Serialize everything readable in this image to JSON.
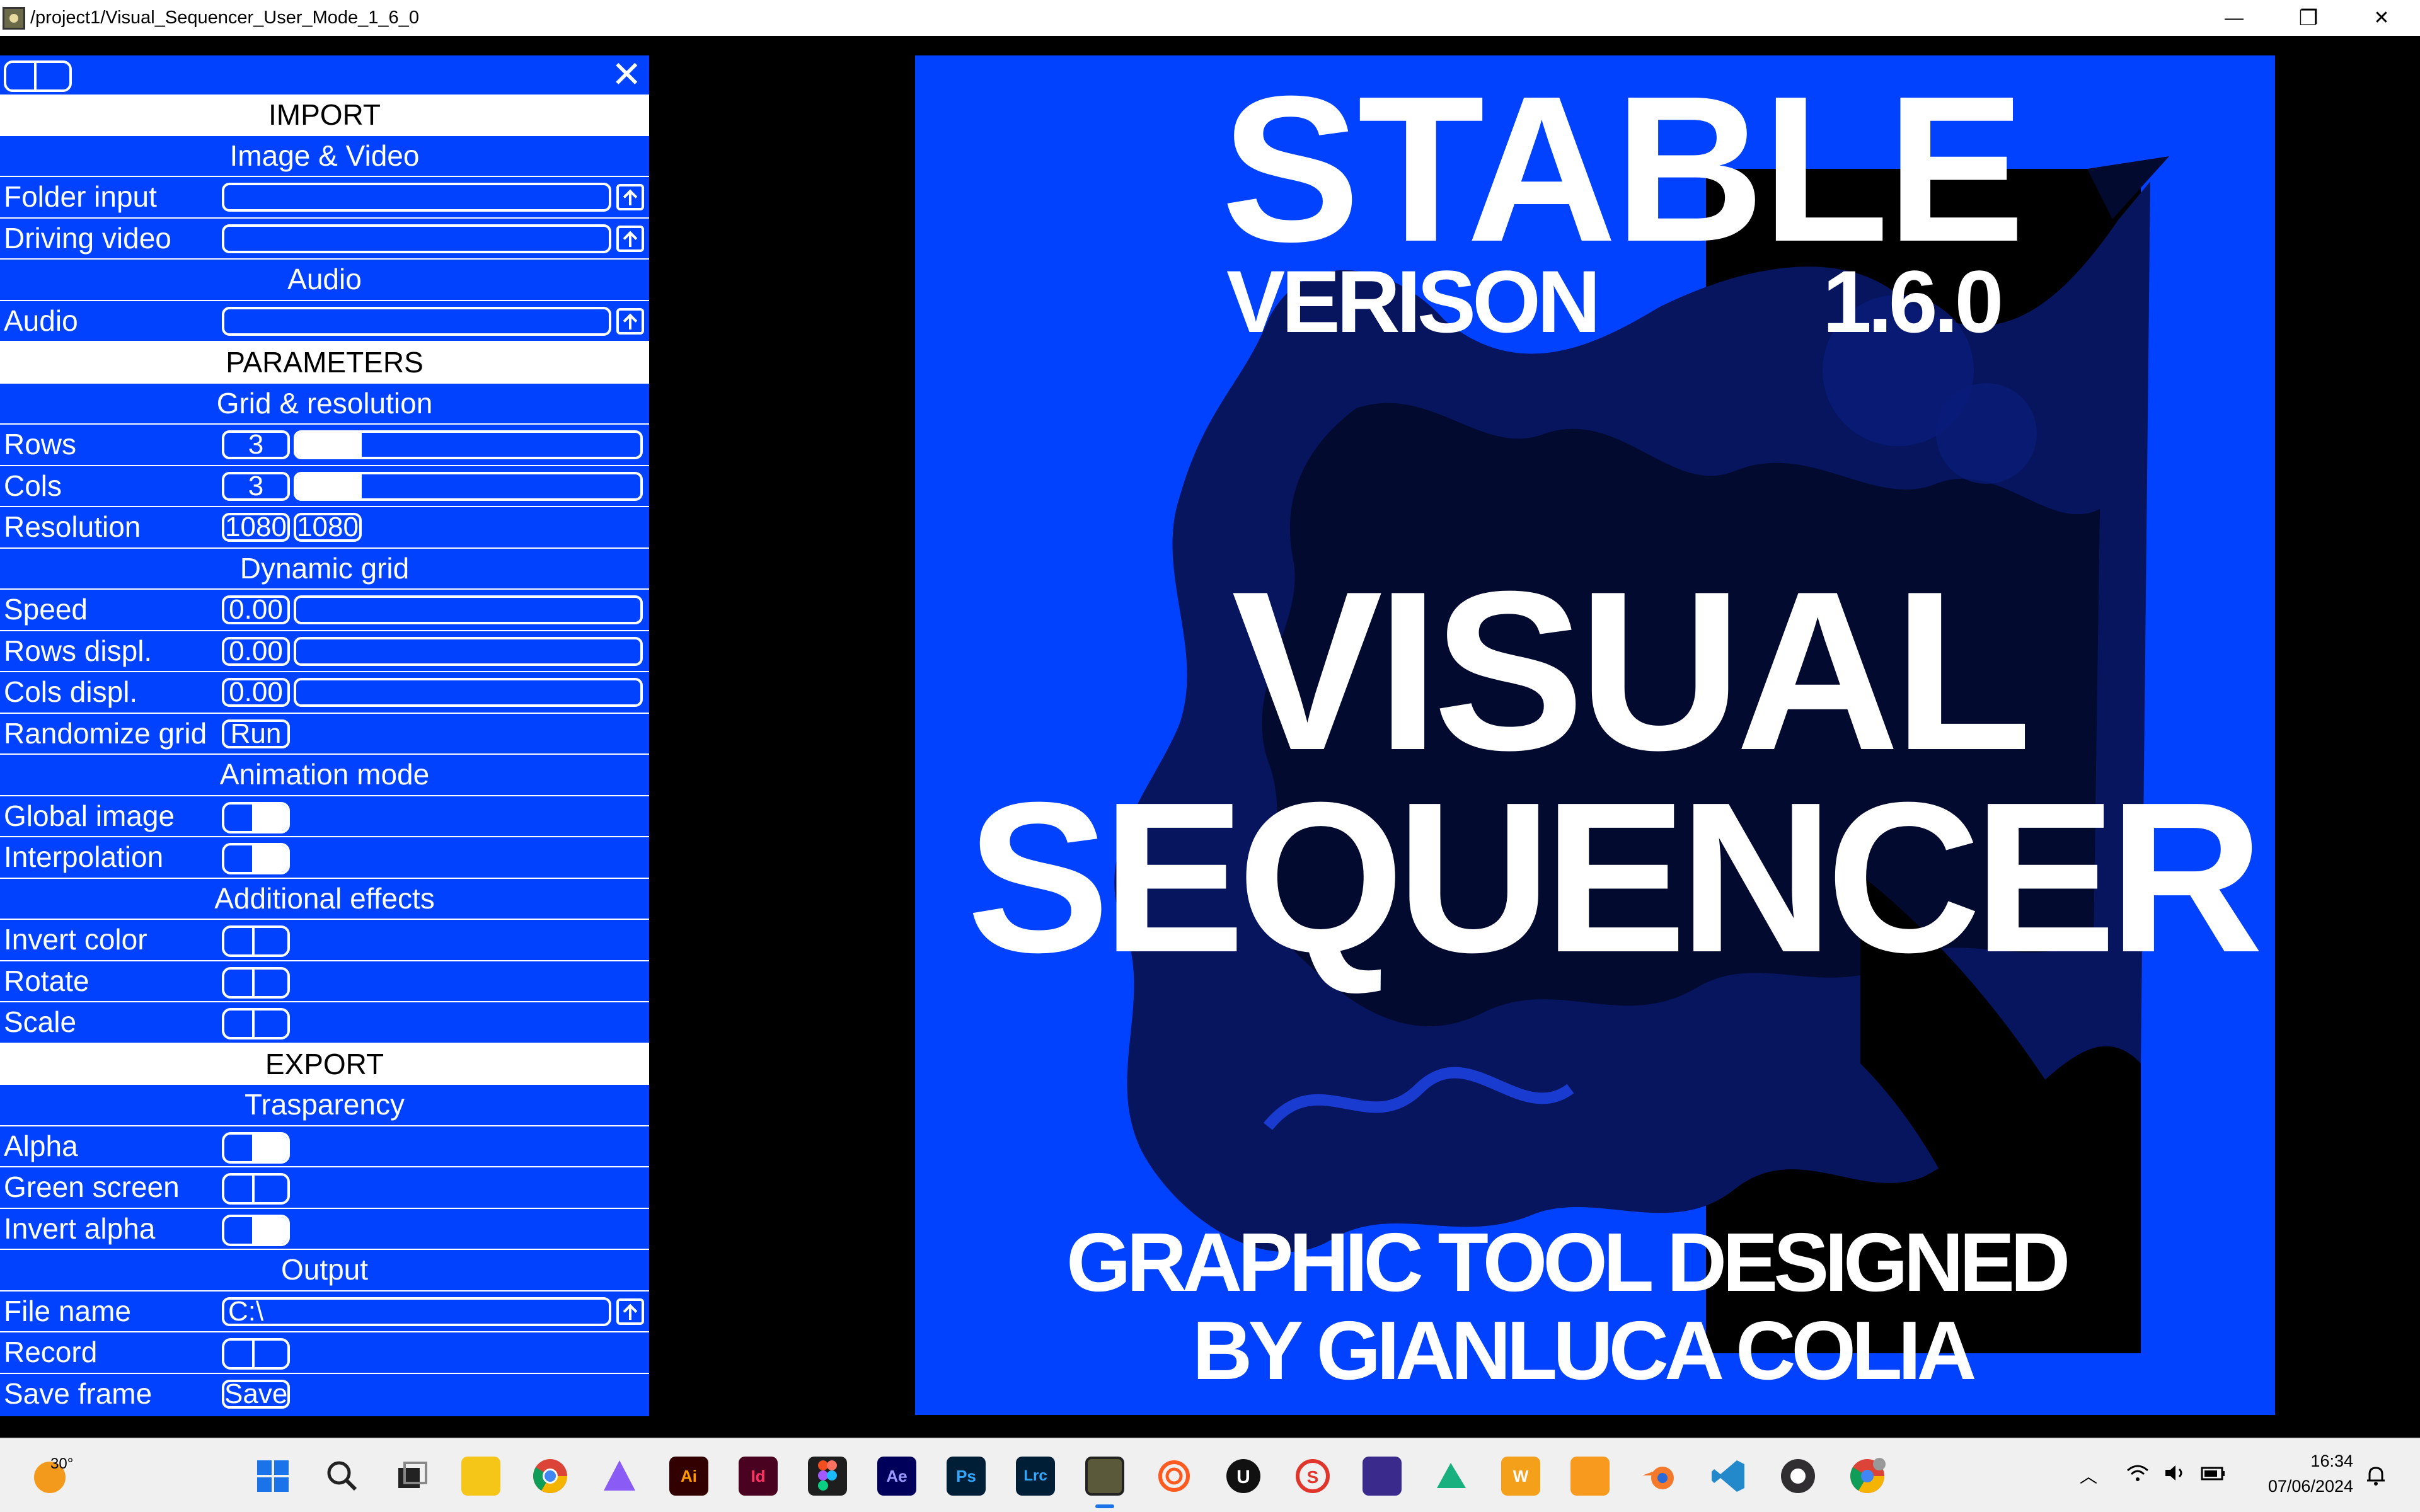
{
  "window": {
    "title": "/project1/Visual_Sequencer_User_Mode_1_6_0",
    "minimize_glyph": "—",
    "restore_glyph": "❐",
    "close_glyph": "✕"
  },
  "panel": {
    "close_glyph": "✕",
    "import": {
      "title": "IMPORT",
      "image_video": "Image & Video",
      "folder_input": "Folder input",
      "folder_input_value": "",
      "driving_video": "Driving video",
      "driving_video_value": "",
      "audio_heading": "Audio",
      "audio": "Audio",
      "audio_value": ""
    },
    "parameters": {
      "title": "PARAMETERS",
      "grid_resolution": "Grid & resolution",
      "rows": "Rows",
      "rows_value": "3",
      "rows_level": 0.19,
      "cols": "Cols",
      "cols_value": "3",
      "cols_level": 0.19,
      "resolution": "Resolution",
      "res_w": "1080",
      "res_h": "1080",
      "dynamic_grid": "Dynamic grid",
      "speed": "Speed",
      "speed_value": "0.00",
      "rows_displ": "Rows displ.",
      "rows_displ_value": "0.00",
      "cols_displ": "Cols displ.",
      "cols_displ_value": "0.00",
      "randomize_grid": "Randomize grid",
      "run": "Run",
      "animation_mode": "Animation mode",
      "global_image": "Global image",
      "global_image_on": true,
      "interpolation": "Interpolation",
      "interpolation_on": true,
      "additional_effects": "Additional effects",
      "invert_color": "Invert color",
      "invert_color_on": false,
      "rotate": "Rotate",
      "rotate_on": false,
      "scale": "Scale",
      "scale_on": false
    },
    "export": {
      "title": "EXPORT",
      "trasparency": "Trasparency",
      "alpha": "Alpha",
      "alpha_on": true,
      "green_screen": "Green screen",
      "green_screen_on": false,
      "invert_alpha": "Invert alpha",
      "invert_alpha_on": true,
      "output": "Output",
      "file_name": "File name",
      "file_name_value": "C:\\",
      "record": "Record",
      "record_on": false,
      "save_frame": "Save frame",
      "save": "Save"
    }
  },
  "preview": {
    "line1": "STABLE",
    "line2a": "VERISON",
    "line2b": "1.6.0",
    "line3": "VISUAL",
    "line4": "SEQUENCER",
    "line5": "GRAPHIC TOOL DESIGNED",
    "line6": "BY GIANLUCA COLIA",
    "bg_color": "#0042ff"
  },
  "taskbar": {
    "weather_temp": "30°",
    "apps": [
      "start-icon",
      "search-icon",
      "task-view-icon",
      "file-explorer-icon",
      "chrome-icon",
      "affinity-icon",
      "illustrator-icon",
      "indesign-icon",
      "figma-icon",
      "after-effects-icon",
      "photoshop-icon",
      "lightroom-classic-icon",
      "touchdesigner-icon",
      "houdini-icon",
      "unreal-engine-icon",
      "substance-icon",
      "pika-icon",
      "artstation-icon",
      "office-icon",
      "box-icon",
      "blender-icon",
      "vscode-icon",
      "obs-icon",
      "chrome-profile-icon"
    ],
    "app_labels": {
      "illustrator": "Ai",
      "indesign": "Id",
      "after_effects": "Ae",
      "photoshop": "Ps",
      "lightroom": "Lrc",
      "office": "W"
    },
    "time": "16:34",
    "date": "07/06/2024"
  }
}
